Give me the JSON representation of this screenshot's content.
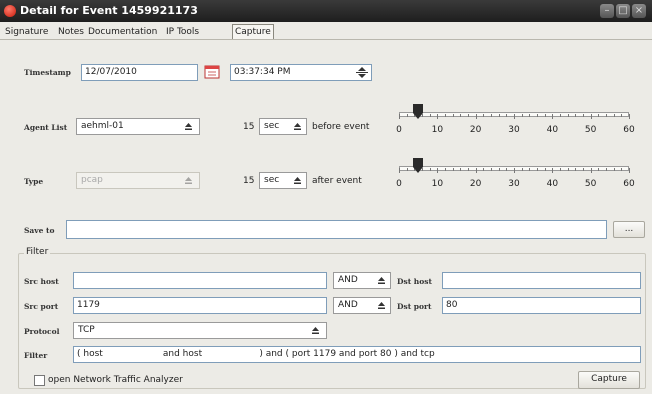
{
  "window": {
    "title": "Detail for Event 1459921173"
  },
  "tabs": [
    {
      "label": "Signature"
    },
    {
      "label": "Notes"
    },
    {
      "label": "Documentation"
    },
    {
      "label": "IP Tools"
    },
    {
      "label": "Capture",
      "active": true
    }
  ],
  "form": {
    "timestamp": {
      "label": "Timestamp",
      "date": "12/07/2010",
      "time": "03:37:34 PM"
    },
    "agent_list": {
      "label": "Agent List",
      "value": "aehml-01"
    },
    "before": {
      "amount": "15",
      "unit": "sec",
      "text": "before event",
      "slider_value": 5
    },
    "type": {
      "label": "Type",
      "value": "pcap"
    },
    "after": {
      "amount": "15",
      "unit": "sec",
      "text": "after event",
      "slider_value": 5
    },
    "save_to": {
      "label": "Save to",
      "value": "",
      "browse_label": "..."
    },
    "slider_ticks": [
      "0",
      "10",
      "20",
      "30",
      "40",
      "50",
      "60"
    ]
  },
  "filter": {
    "title": "Filter",
    "src_host": {
      "label": "Src host",
      "value": ""
    },
    "host_op": "AND",
    "dst_host": {
      "label": "Dst host",
      "value": ""
    },
    "src_port": {
      "label": "Src port",
      "value": "1179"
    },
    "port_op": "AND",
    "dst_port": {
      "label": "Dst port",
      "value": "80"
    },
    "protocol": {
      "label": "Protocol",
      "value": "TCP"
    },
    "filter_expr": {
      "label": "Filter",
      "value": "( host                     and host                    ) and ( port 1179 and port 80 ) and tcp"
    }
  },
  "bottom": {
    "open_analyzer_label": "open Network Traffic Analyzer",
    "capture_label": "Capture"
  },
  "colors": {
    "title_bg": "#2b2b2b",
    "field_border": "#7f9db9",
    "panel_bg": "#ecebe6"
  },
  "icons": [
    "window-icon",
    "calendar-icon",
    "spin-icon",
    "dropdown-arrow-icon",
    "minimize-icon",
    "maximize-icon",
    "close-icon"
  ]
}
